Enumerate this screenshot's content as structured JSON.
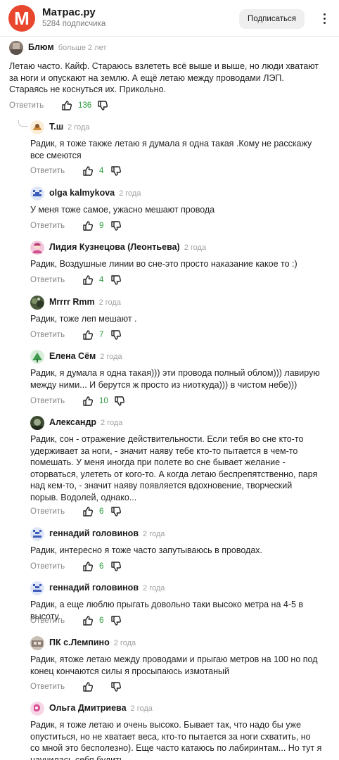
{
  "channel": {
    "name": "Матрас.ру",
    "logo_letter": "M",
    "subscribers": "5284 подписчика",
    "subscribe_label": "Подписаться",
    "brand_color": "#e8472e"
  },
  "ui": {
    "reply_label": "Ответить",
    "like_color": "#2e9e40"
  },
  "comments": [
    {
      "author": "Блюм",
      "time": "больше 2 лет",
      "text": "Летаю часто. Кайф. Стараюсь взлететь всё выше и выше, но люди хватают за ноги и опускают на землю. А ещё летаю между проводами ЛЭП. Стараясь не коснуться их. Прикольно.",
      "likes": "136"
    },
    {
      "author": "Т.ш",
      "time": "2 года",
      "text": "Радик, я тоже также летаю я думала я одна такая .Кому не расскажу все смеются",
      "likes": "4"
    },
    {
      "author": "olga kalmykova",
      "time": "2 года",
      "text": "У меня тоже самое, ужасно мешают провода",
      "likes": "9"
    },
    {
      "author": "Лидия Кузнецова (Леонтьева)",
      "time": "2 года",
      "text": "Радик, Воздушные линии во сне-это просто наказание какое то :)",
      "likes": "4"
    },
    {
      "author": "Mrrrr Rmm",
      "time": "2 года",
      "text": "Радик, тоже леп мешают .",
      "likes": "7"
    },
    {
      "author": "Елена Сём",
      "time": "2 года",
      "text": "Радик, я думала я одна такая))) эти провода полный облом))) лавирую между ними... И берутся ж просто из ниоткуда))) в чистом небе)))",
      "likes": "10"
    },
    {
      "author": "Александр",
      "time": "2 года",
      "text": "Радик, сон - отражение действительности. Если тебя во сне кто-то удерживает за ноги, - значит наяву тебе кто-то пытается в чем-то помешать. У меня иногда при полете во сне бывает желание - оторваться, улететь от кого-то. А когда летаю беспрепятственно, паря над кем-то, - значит наяву появляется вдохновение, творческий порыв. Водолей, однако...",
      "likes": "6"
    },
    {
      "author": "геннадий головинов",
      "time": "2 года",
      "text": "Радик, интересно я тоже часто запутываюсь в проводах.",
      "likes": "6"
    },
    {
      "author": "геннадий головинов",
      "time": "2 года",
      "text": "Радик, а еще люблю прыгать довольно таки высоко метра на 4-5 в высоту.",
      "likes": "6"
    },
    {
      "author": "ПК с.Лемпино",
      "time": "2 года",
      "text": "Радик, ятоже летаю между проводами и прыгаю метров на 100 но под конец кончаются силы я просыпаюсь измотаный",
      "likes": ""
    },
    {
      "author": "Ольга Дмитриева",
      "time": "2 года",
      "text": "Радик, я тоже летаю и очень высоко. Бывает так, что надо бы уже опуститься, но не хватает веса, кто-то пытается за ноги схватить, но со мной это бесполезно). Еще часто катаюсь по лабиринтам... Но тут я научилась себя будить",
      "likes": ""
    }
  ]
}
